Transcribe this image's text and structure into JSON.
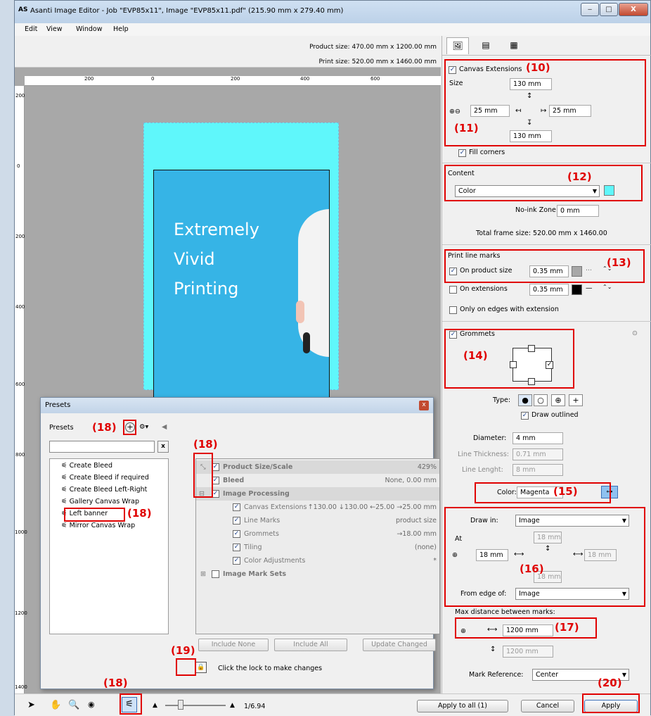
{
  "window": {
    "app_logo": "AS",
    "title": "Asanti Image Editor - Job \"EVP85x11\", Image \"EVP85x11.pdf\" (215.90 mm x 279.40 mm)",
    "controls": {
      "minimize": "‒",
      "maximize": "□",
      "close": "X"
    }
  },
  "menu": [
    "Edit",
    "View",
    "Window",
    "Help"
  ],
  "canvas": {
    "product_size": "Product size: 470.00 mm x 1200.00 mm",
    "print_size": "Print size: 520.00 mm x 1460.00 mm",
    "ruler_h": [
      "200",
      "0",
      "200",
      "400",
      "600"
    ],
    "ruler_v": [
      "200",
      "0",
      "200",
      "400",
      "600",
      "800",
      "1000",
      "1200",
      "1400"
    ],
    "artwork_lines": [
      "Extremely",
      "Vivid",
      "Printing"
    ]
  },
  "panel": {
    "tabs": [
      "image-icon",
      "layout-icon",
      "grid-icon"
    ],
    "canvas_extensions": {
      "label": "Canvas Extensions",
      "checked": true,
      "size_label": "Size",
      "top": "130 mm",
      "left": "25 mm",
      "right": "25 mm",
      "bottom": "130 mm",
      "fill_corners": "Fill corners"
    },
    "content": {
      "label": "Content",
      "type": "Color",
      "swatch_color": "#5ff7fb",
      "no_ink_label": "No-ink Zone",
      "no_ink_value": "0 mm",
      "total_frame": "Total frame size:   520.00 mm x 1460.00"
    },
    "print_line_marks": {
      "label": "Print line marks",
      "on_product_label": "On product size",
      "on_product_value": "0.35 mm",
      "on_product_color": "#a8a8a8",
      "on_ext_label": "On extensions",
      "on_ext_value": "0.35 mm",
      "on_ext_color": "#000000",
      "only_edges": "Only on edges with extension"
    },
    "grommets": {
      "label": "Grommets",
      "type_label": "Type:",
      "type_options": [
        "●",
        "○",
        "⊕",
        "+"
      ],
      "draw_outlined": "Draw outlined",
      "diameter_label": "Diameter:",
      "diameter": "4 mm",
      "line_thickness_label": "Line Thickness:",
      "line_thickness": "0.71 mm",
      "line_length_label": "Line Lenght:",
      "line_length": "8 mm",
      "color_label": "Color:",
      "color": "Magenta",
      "draw_in_label": "Draw in:",
      "draw_in": "Image",
      "at_label": "At",
      "at_top": "18 mm",
      "at_left": "18 mm",
      "at_right": "18 mm",
      "at_bottom": "18 mm",
      "from_edge_label": "From edge of:",
      "from_edge": "Image",
      "max_dist_label": "Max distance between marks:",
      "max_dist_h": "1200 mm",
      "max_dist_v": "1200 mm",
      "mark_ref_label": "Mark Reference:",
      "mark_ref": "Center"
    }
  },
  "presets": {
    "title": "Presets",
    "header": "Presets",
    "close": "x",
    "search_clear": "x",
    "items": [
      "Create Bleed",
      "Create Bleed if required",
      "Create Bleed Left-Right",
      "Gallery Canvas Wrap",
      "Left banner",
      "Mirror Canvas Wrap"
    ],
    "rows": [
      {
        "label": "Product Size/Scale",
        "value": "429%"
      },
      {
        "label": "Bleed",
        "value": "None, 0.00 mm"
      },
      {
        "label": "Image Processing",
        "value": ""
      },
      {
        "label": "Canvas Extensions",
        "value": "↑130.00  ↓130.00  ←25.00  →25.00 mm"
      },
      {
        "label": "Line Marks",
        "value": "product size"
      },
      {
        "label": "Grommets",
        "value": "→18.00 mm"
      },
      {
        "label": "Tiling",
        "value": "(none)"
      },
      {
        "label": "Color Adjustments",
        "value": "*"
      },
      {
        "label": "Image Mark Sets",
        "value": ""
      }
    ],
    "btn_include_none": "Include None",
    "btn_include_all": "Include All",
    "btn_update": "Update Changed",
    "lock_text": "Click the lock to make changes"
  },
  "statusbar": {
    "zoom": "1/6.94",
    "apply_all": "Apply to all (1)",
    "cancel": "Cancel",
    "apply": "Apply"
  },
  "callouts": {
    "c10": "(10)",
    "c11": "(11)",
    "c12": "(12)",
    "c13": "(13)",
    "c14": "(14)",
    "c15": "(15)",
    "c16": "(16)",
    "c17": "(17)",
    "c18": "(18)",
    "c19": "(19)",
    "c20": "(20)"
  }
}
